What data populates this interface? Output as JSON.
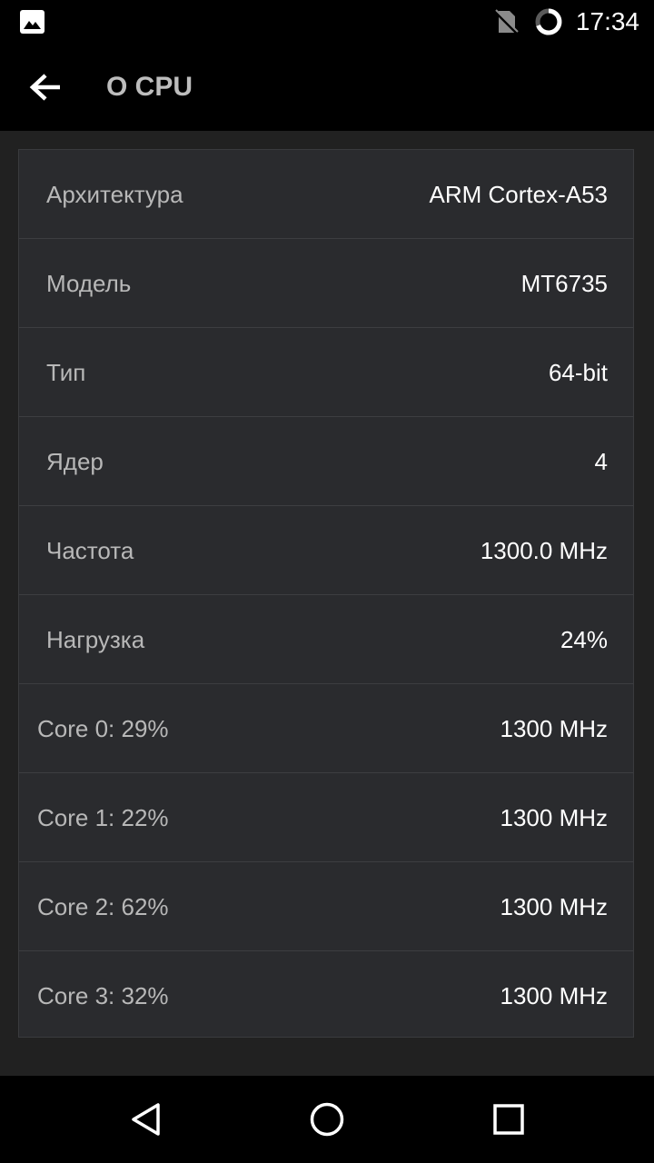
{
  "status_bar": {
    "time": "17:34",
    "icons": [
      "image-icon",
      "no-sim-icon",
      "battery-icon"
    ]
  },
  "app_bar": {
    "title": "О CPU",
    "back_icon": "arrow-back-icon"
  },
  "rows": [
    {
      "label": "Архитектура",
      "value": "ARM Cortex-A53"
    },
    {
      "label": "Модель",
      "value": "MT6735"
    },
    {
      "label": "Тип",
      "value": "64-bit"
    },
    {
      "label": "Ядер",
      "value": "4"
    },
    {
      "label": "Частота",
      "value": "1300.0 MHz"
    },
    {
      "label": "Нагрузка",
      "value": "24%"
    }
  ],
  "cores": [
    {
      "label": "Core 0: 29%",
      "value": "1300 MHz"
    },
    {
      "label": "Core 1: 22%",
      "value": "1300 MHz"
    },
    {
      "label": "Core 2: 62%",
      "value": "1300 MHz"
    },
    {
      "label": "Core 3: 32%",
      "value": "1300 MHz"
    }
  ],
  "nav_bar": {
    "icons": [
      "nav-back-icon",
      "nav-home-icon",
      "nav-recents-icon"
    ]
  },
  "colors": {
    "background": "#212121",
    "bar": "#000000",
    "card": "#2a2b2e",
    "label": "#b8b8b8",
    "value": "#ffffff"
  }
}
